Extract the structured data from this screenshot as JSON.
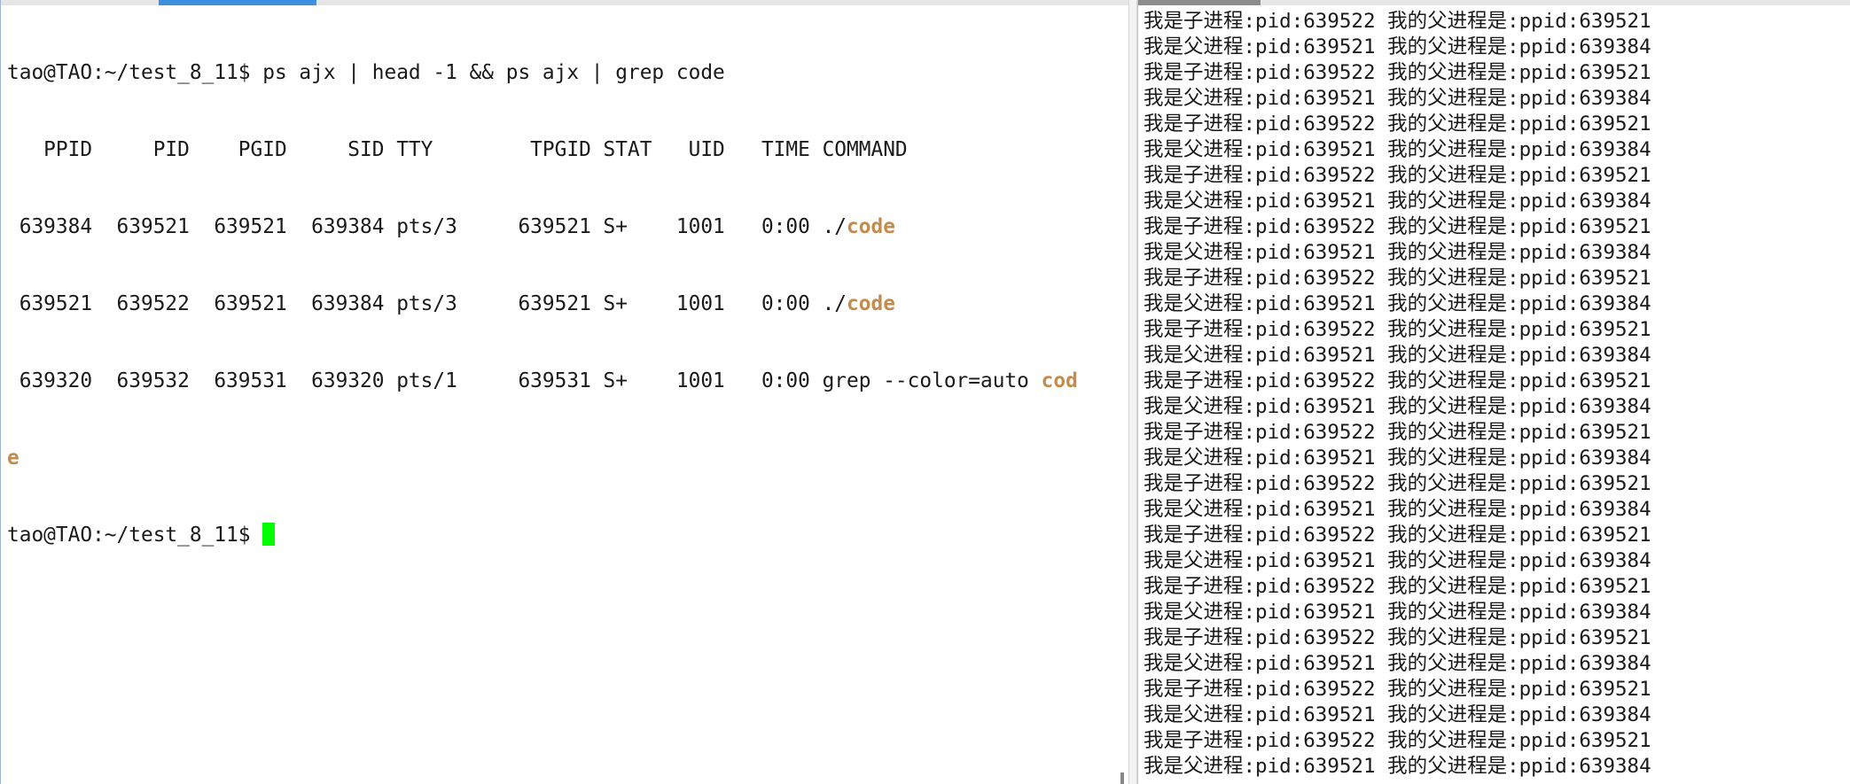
{
  "left_terminal": {
    "prompt": "tao@TAO:~/test_8_11$ ",
    "command": "ps ajx | head -1 && ps ajx | grep code",
    "header": "   PPID     PID    PGID     SID TTY        TPGID STAT   UID   TIME COMMAND",
    "rows": [
      {
        "prefix": " 639384  639521  639521  639384 pts/3     639521 S+    1001   0:00 ./",
        "highlight": "code",
        "suffix": ""
      },
      {
        "prefix": " 639521  639522  639521  639384 pts/3     639521 S+    1001   0:00 ./",
        "highlight": "code",
        "suffix": ""
      },
      {
        "prefix": " 639320  639532  639531  639320 pts/1     639531 S+    1001   0:00 grep --color=auto ",
        "highlight": "cod",
        "suffix": ""
      }
    ],
    "wrap_highlight": "e",
    "final_prompt": "tao@TAO:~/test_8_11$ "
  },
  "right_terminal": {
    "child": {
      "label_a": "我是子进程",
      "pid": ":pid:639522 ",
      "label_b": "我的父进程是",
      "ppid": ":ppid:639521"
    },
    "parent": {
      "label_a": "我是父进程",
      "pid": ":pid:639521 ",
      "label_b": "我的父进程是",
      "ppid": ":ppid:639384"
    }
  }
}
